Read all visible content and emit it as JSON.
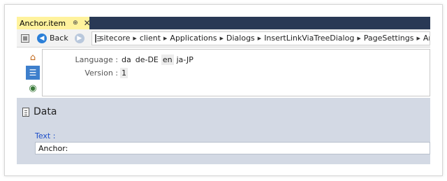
{
  "tab": {
    "title": "Anchor.item",
    "pin": "⊕",
    "close": "✕"
  },
  "toolbar": {
    "back_label": "Back",
    "breadcrumbs": [
      "sitecore",
      "client",
      "Applications",
      "Dialogs",
      "InsertLinkViaTreeDialog",
      "PageSettings",
      "Anchor"
    ]
  },
  "properties": {
    "language_label": "Language :",
    "languages": [
      "da",
      "de-DE",
      "en",
      "ja-JP"
    ],
    "selected_language": "en",
    "version_label": "Version :",
    "version_value": "1"
  },
  "data_section": {
    "title": "Data",
    "field_label": "Text :",
    "field_value": "Anchor:"
  },
  "colors": {
    "tab_active": "#fff29d",
    "tabstrip_bg": "#293955",
    "section_bg": "#d3d9e4",
    "field_label": "#1d4ec8"
  },
  "icons": {
    "rail": [
      "home-icon",
      "tree-icon",
      "globe-icon"
    ],
    "toolbar": [
      "item-icon",
      "back-icon",
      "forward-icon",
      "path-item-icon"
    ],
    "section": "data-section-icon"
  }
}
